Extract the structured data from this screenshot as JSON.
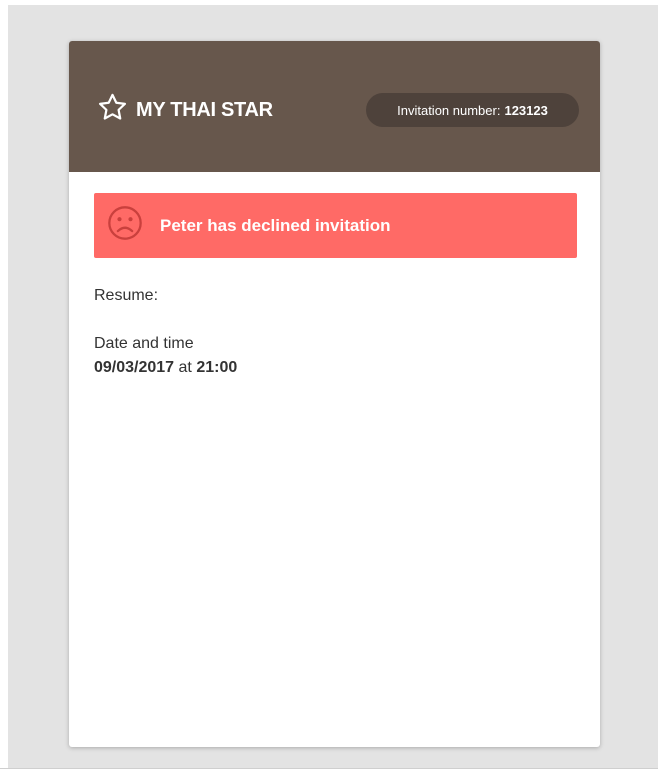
{
  "header": {
    "brand_title": "MY THAI STAR",
    "brand_icon": "star-outline-icon",
    "invitation_label": "Invitation number:",
    "invitation_number": "123123"
  },
  "alert": {
    "icon": "sad-face-icon",
    "message": "Peter has declined invitation",
    "color": "#ff6a66"
  },
  "details": {
    "resume_label": "Resume:",
    "date_time_label": "Date and time",
    "date": "09/03/2017",
    "at_word": "at",
    "time": "21:00"
  },
  "colors": {
    "header_bg": "#67574c",
    "pill_bg": "#4e423b",
    "page_bg": "#e3e3e3"
  }
}
